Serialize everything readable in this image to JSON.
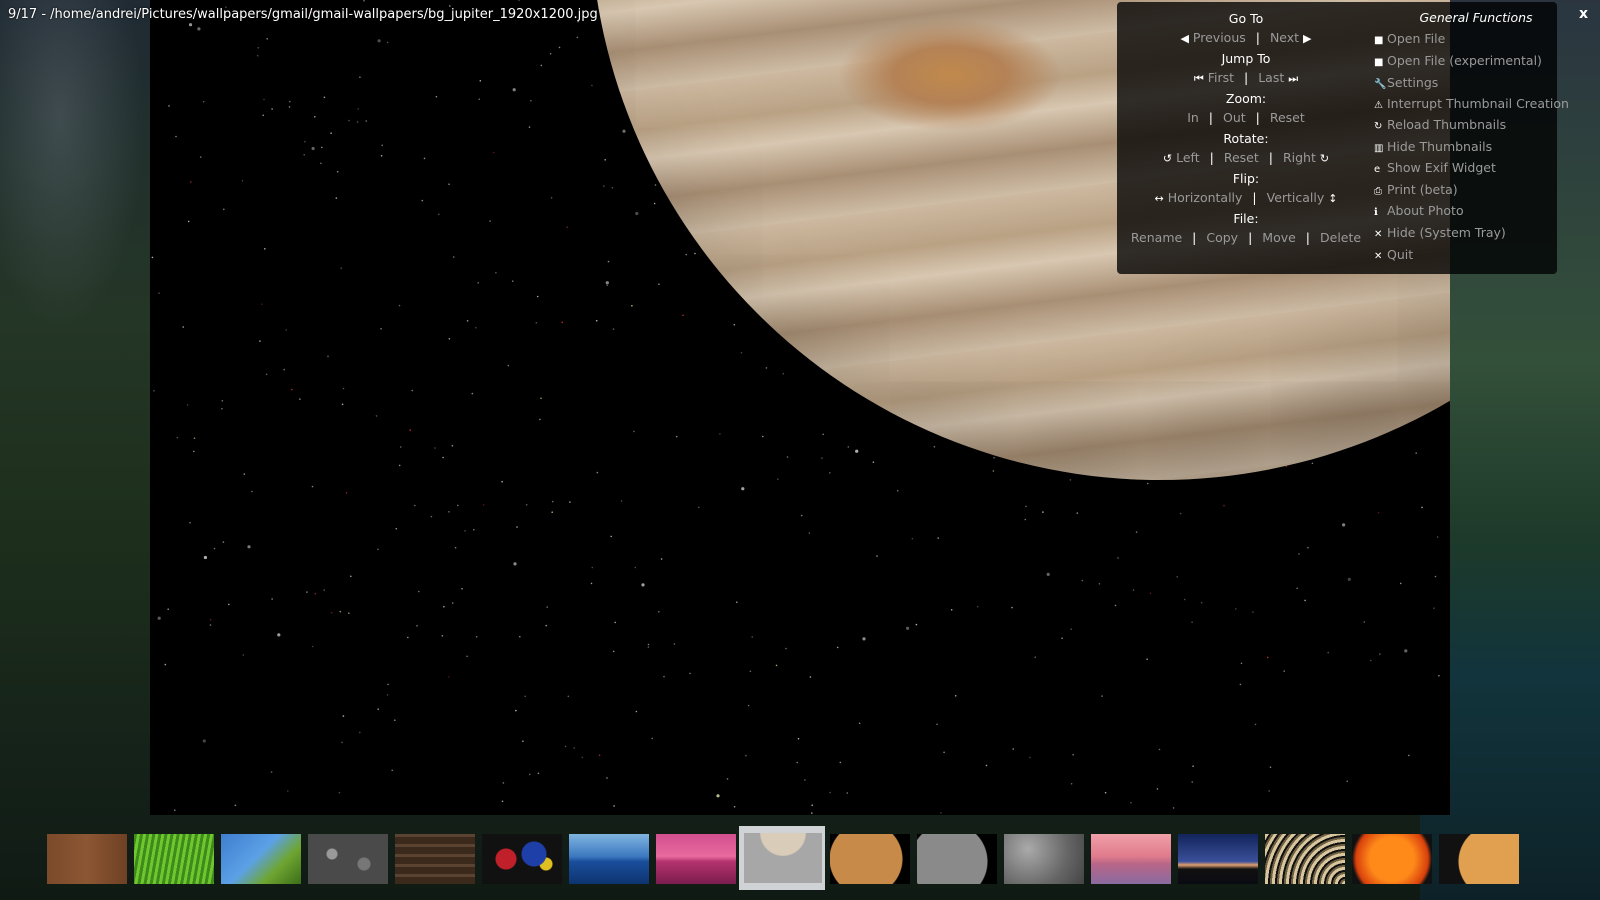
{
  "window": {
    "title": "9/17  - /home/andrei/Pictures/wallpapers/gmail/gmail-wallpapers/bg_jupiter_1920x1200.jpg",
    "close_label": "x"
  },
  "navigation": {
    "goto": {
      "title": "Go To",
      "previous": "Previous",
      "next": "Next"
    },
    "jumpto": {
      "title": "Jump To",
      "first": "First",
      "last": "Last"
    },
    "zoom": {
      "title": "Zoom:",
      "in": "In",
      "out": "Out",
      "reset": "Reset"
    },
    "rotate": {
      "title": "Rotate:",
      "left": "Left",
      "reset": "Reset",
      "right": "Right"
    },
    "flip": {
      "title": "Flip:",
      "horizontally": "Horizontally",
      "vertically": "Vertically"
    },
    "file": {
      "title": "File:",
      "rename": "Rename",
      "copy": "Copy",
      "move": "Move",
      "delete": "Delete"
    }
  },
  "general": {
    "title": "General Functions",
    "items": [
      {
        "label": "Open File",
        "icon": "folder-icon"
      },
      {
        "label": "Open File (experimental)",
        "icon": "folder-icon"
      },
      {
        "label": "Settings",
        "icon": "wrench-icon"
      },
      {
        "label": "Interrupt Thumbnail Creation",
        "icon": "warning-icon"
      },
      {
        "label": "Reload Thumbnails",
        "icon": "reload-icon"
      },
      {
        "label": "Hide Thumbnails",
        "icon": "thumbnails-icon"
      },
      {
        "label": "Show Exif Widget",
        "icon": "exif-icon"
      },
      {
        "label": "Print (beta)",
        "icon": "printer-icon"
      },
      {
        "label": "About Photo",
        "icon": "info-icon"
      },
      {
        "label": "Hide (System Tray)",
        "icon": "close-icon"
      },
      {
        "label": "Quit",
        "icon": "close-icon"
      }
    ]
  },
  "thumbnails": {
    "current_index": 9,
    "total": 17,
    "items": [
      {
        "name": "wood-light"
      },
      {
        "name": "grass"
      },
      {
        "name": "leaves-sky"
      },
      {
        "name": "pebbles"
      },
      {
        "name": "wood-dark"
      },
      {
        "name": "graffiti"
      },
      {
        "name": "ocean"
      },
      {
        "name": "pink-sea"
      },
      {
        "name": "jupiter",
        "active": true
      },
      {
        "name": "mars"
      },
      {
        "name": "mercury"
      },
      {
        "name": "moon"
      },
      {
        "name": "pink-sunset"
      },
      {
        "name": "dusk-horizon"
      },
      {
        "name": "saturn-rings"
      },
      {
        "name": "sun"
      },
      {
        "name": "venus"
      }
    ]
  }
}
